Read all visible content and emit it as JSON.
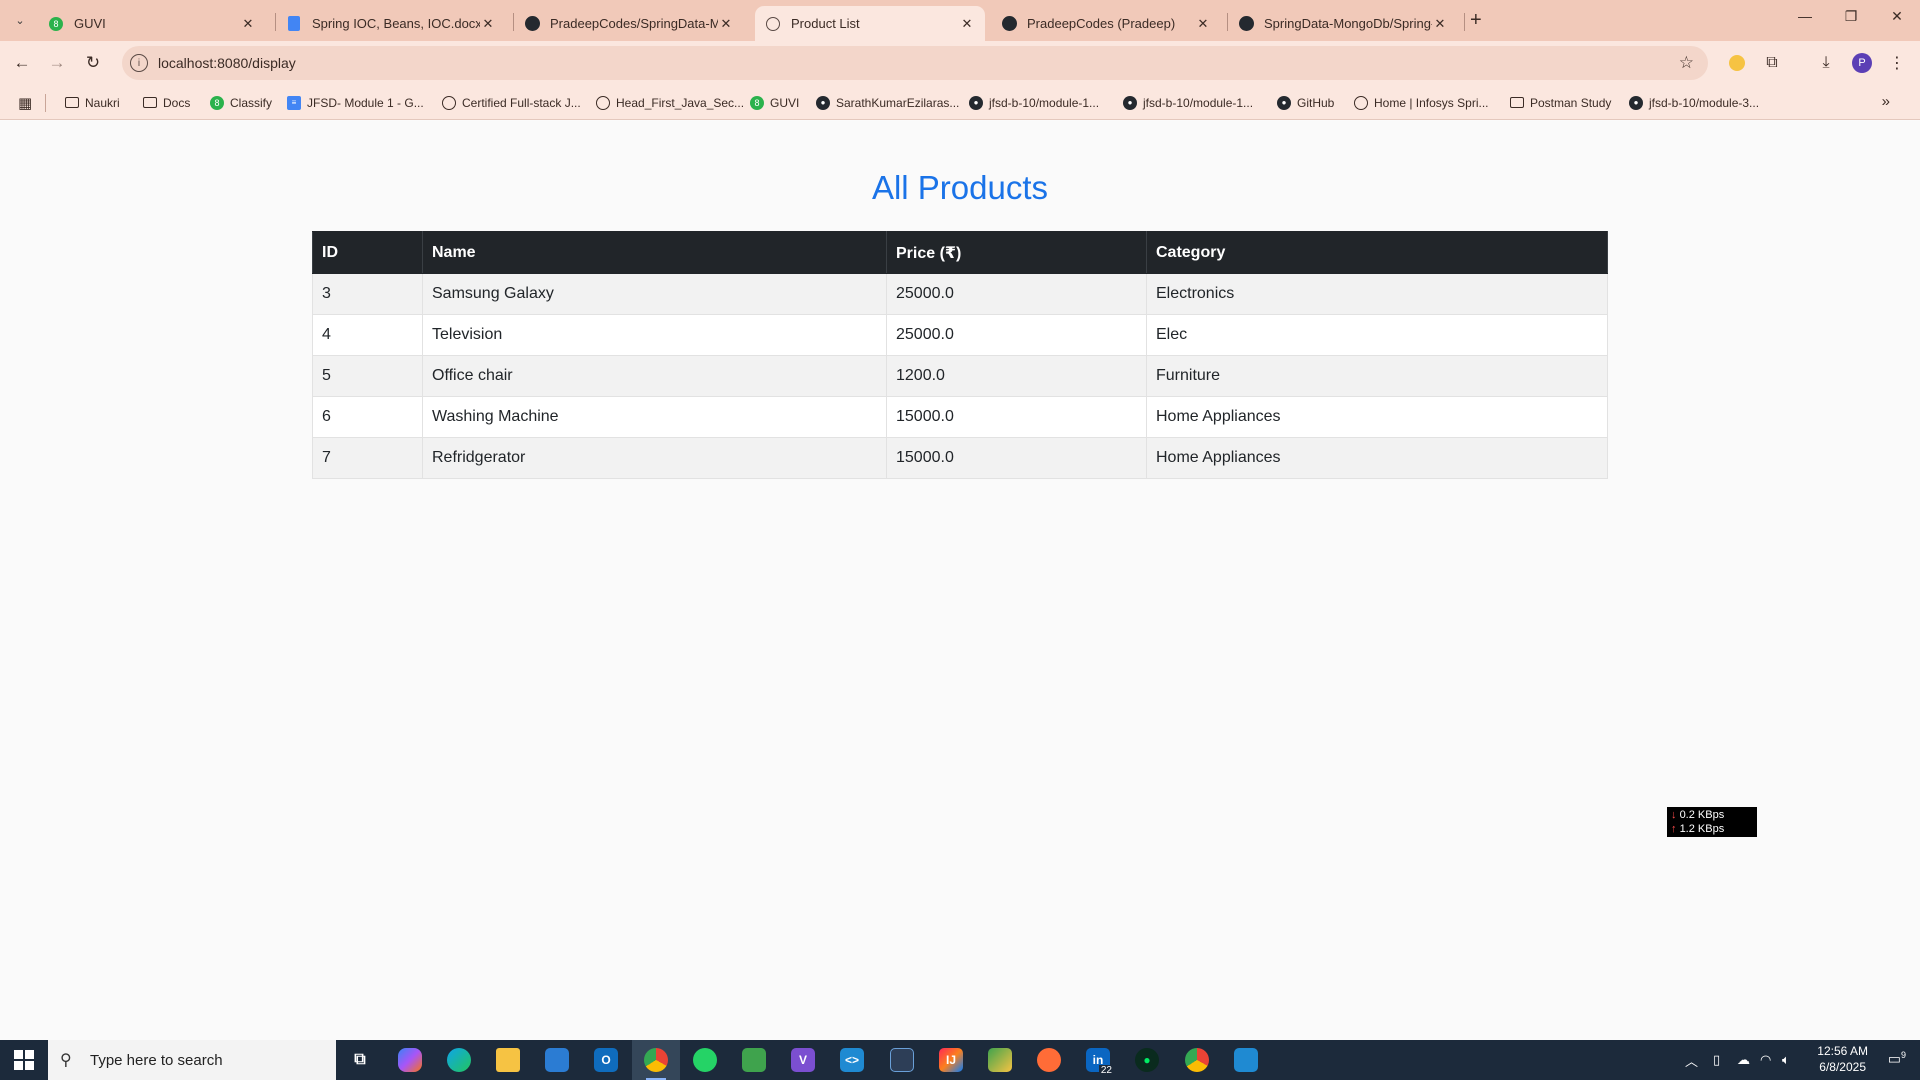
{
  "browser": {
    "tabs": [
      {
        "title": "GUVI",
        "icon": "guvi-icon",
        "active": false
      },
      {
        "title": "Spring IOC, Beans, IOC.docx - G",
        "icon": "google-docs-icon",
        "active": false
      },
      {
        "title": "PradeepCodes/SpringData-Mo",
        "icon": "github-icon",
        "active": false
      },
      {
        "title": "Product List",
        "icon": "globe-icon",
        "active": true
      },
      {
        "title": "PradeepCodes (Pradeep)",
        "icon": "github-icon",
        "active": false
      },
      {
        "title": "SpringData-MongoDb/Spring-D",
        "icon": "github-icon",
        "active": false
      }
    ],
    "url": "localhost:8080/display",
    "profile_initial": "P",
    "bookmarks": [
      {
        "label": "Naukri",
        "icon": "folder-icon"
      },
      {
        "label": "Docs",
        "icon": "folder-icon"
      },
      {
        "label": "Classify",
        "icon": "guvi-icon"
      },
      {
        "label": "JFSD- Module 1 - G...",
        "icon": "google-docs-icon"
      },
      {
        "label": "Certified Full-stack J...",
        "icon": "globe-icon"
      },
      {
        "label": "Head_First_Java_Sec...",
        "icon": "globe-icon"
      },
      {
        "label": "GUVI",
        "icon": "guvi-icon"
      },
      {
        "label": "SarathKumarEzilaras...",
        "icon": "github-icon"
      },
      {
        "label": "jfsd-b-10/module-1...",
        "icon": "github-icon"
      },
      {
        "label": "jfsd-b-10/module-1...",
        "icon": "github-icon"
      },
      {
        "label": "GitHub",
        "icon": "github-icon"
      },
      {
        "label": "Home | Infosys Spri...",
        "icon": "globe-icon"
      },
      {
        "label": "Postman Study",
        "icon": "folder-icon"
      },
      {
        "label": "jfsd-b-10/module-3...",
        "icon": "github-icon"
      }
    ]
  },
  "page": {
    "title": "All Products",
    "table": {
      "headers": [
        "ID",
        "Name",
        "Price (₹)",
        "Category"
      ],
      "rows": [
        [
          "3",
          "Samsung Galaxy",
          "25000.0",
          "Electronics"
        ],
        [
          "4",
          "Television",
          "25000.0",
          "Elec"
        ],
        [
          "5",
          "Office chair",
          "1200.0",
          "Furniture"
        ],
        [
          "6",
          "Washing Machine",
          "15000.0",
          "Home Appliances"
        ],
        [
          "7",
          "Refridgerator",
          "15000.0",
          "Home Appliances"
        ]
      ]
    },
    "title_color": "#1a73e8",
    "header_bg": "#212529"
  },
  "net_meter": {
    "down": "0.2 KBps",
    "up": "1.2 KBps"
  },
  "taskbar": {
    "search_placeholder": "Type here to search",
    "apps": [
      "task-view-icon",
      "copilot-icon",
      "edge-icon",
      "file-explorer-icon",
      "store-icon",
      "outlook-icon",
      "chrome-icon",
      "whatsapp-icon",
      "notepad-icon",
      "visual-studio-icon",
      "vscode-icon",
      "ide-icon",
      "intellij-icon",
      "tool-icon",
      "postman-icon",
      "linkedin-icon",
      "mongodb-compass-icon",
      "chrome-icon",
      "app-icon"
    ],
    "linkedin_badge": "22",
    "time": "12:56 AM",
    "date": "6/8/2025",
    "notification_count": "9"
  }
}
